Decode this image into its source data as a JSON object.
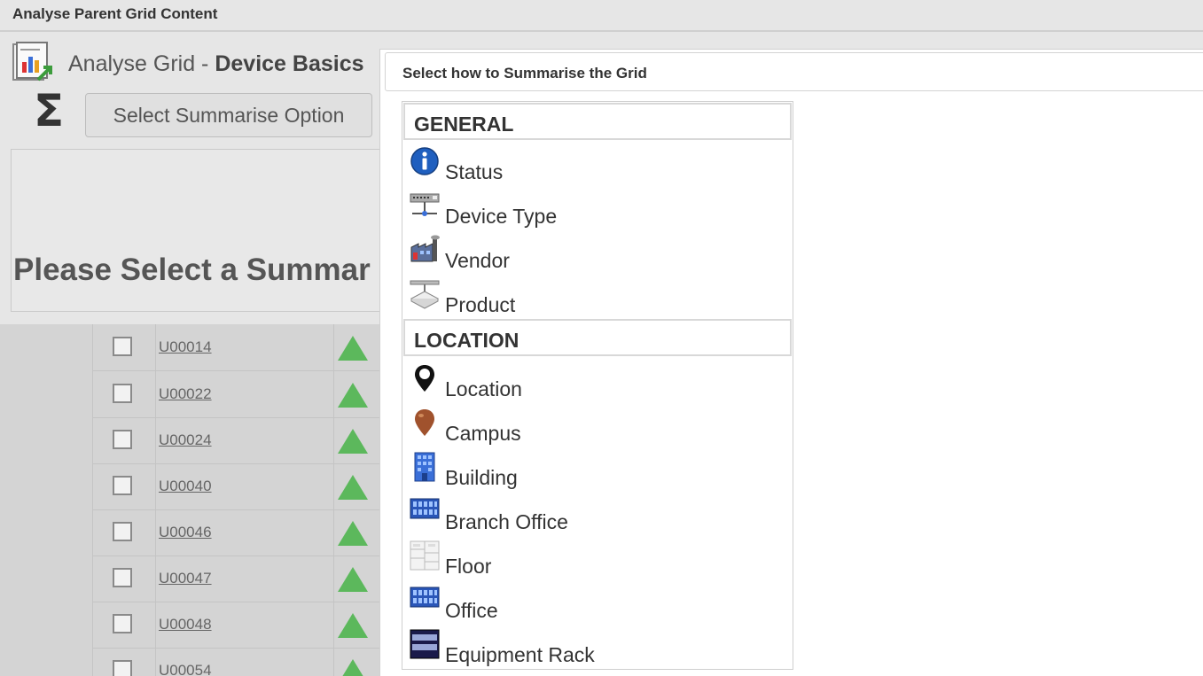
{
  "window": {
    "title": "Analyse Parent Grid Content"
  },
  "analyse": {
    "title_prefix": "Analyse Grid - ",
    "title_bold": "Device Basics"
  },
  "summarise": {
    "sigma": "Σ",
    "button_label": "Select Summarise Option"
  },
  "summary_panel": {
    "message": "Please Select a Summar"
  },
  "grid": {
    "rows": [
      {
        "id": "U00014"
      },
      {
        "id": "U00022"
      },
      {
        "id": "U00024"
      },
      {
        "id": "U00040"
      },
      {
        "id": "U00046"
      },
      {
        "id": "U00047"
      },
      {
        "id": "U00048"
      },
      {
        "id": "U00054"
      }
    ]
  },
  "dialog": {
    "title": "Select how to Summarise the Grid",
    "groups": [
      {
        "label": "GENERAL",
        "items": [
          {
            "label": "Status",
            "icon": "info-icon"
          },
          {
            "label": "Device Type",
            "icon": "network-switch-icon"
          },
          {
            "label": "Vendor",
            "icon": "factory-icon"
          },
          {
            "label": "Product",
            "icon": "device-box-icon"
          }
        ]
      },
      {
        "label": "LOCATION",
        "items": [
          {
            "label": "Location",
            "icon": "map-pin-black-icon"
          },
          {
            "label": "Campus",
            "icon": "map-pin-brown-icon"
          },
          {
            "label": "Building",
            "icon": "building-icon"
          },
          {
            "label": "Branch Office",
            "icon": "branch-office-icon"
          },
          {
            "label": "Floor",
            "icon": "floor-plan-icon"
          },
          {
            "label": "Office",
            "icon": "office-icon"
          },
          {
            "label": "Equipment Rack",
            "icon": "equipment-rack-icon"
          }
        ]
      }
    ]
  },
  "colors": {
    "status_up": "#5cb85c",
    "info_blue": "#1f5fbf",
    "campus_brown": "#a0522d"
  }
}
